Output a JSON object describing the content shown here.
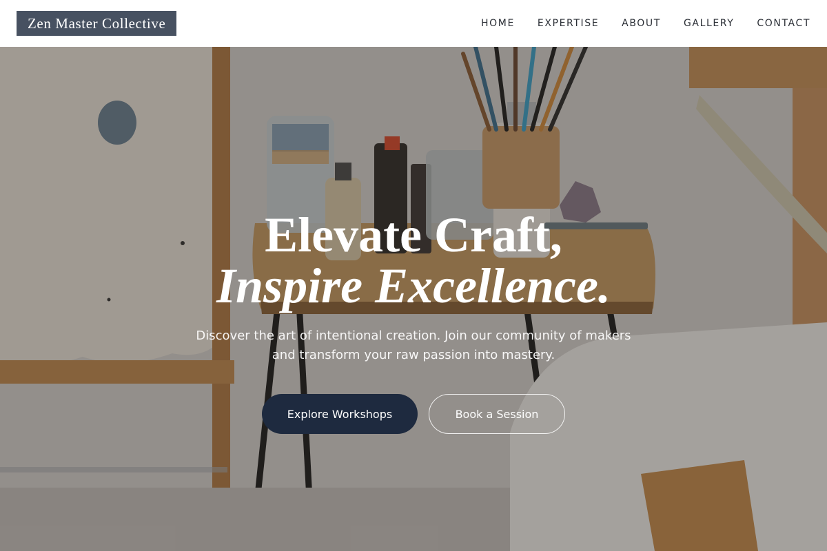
{
  "header": {
    "logo": "Zen Master Collective",
    "nav": [
      {
        "label": "HOME"
      },
      {
        "label": "EXPERTISE"
      },
      {
        "label": "ABOUT"
      },
      {
        "label": "GALLERY"
      },
      {
        "label": "CONTACT"
      }
    ]
  },
  "hero": {
    "title_line1": "Elevate Craft,",
    "title_line2": "Inspire Excellence.",
    "subtitle": "Discover the art of intentional creation. Join our community of makers and transform your raw passion into mastery.",
    "primary_button": "Explore Workshops",
    "secondary_button": "Book a Session",
    "background_image": "artist-studio-table-photo"
  },
  "colors": {
    "logo_bg": "#475161",
    "primary_button_bg": "#1e2a3f",
    "nav_text": "#2b2f36"
  }
}
